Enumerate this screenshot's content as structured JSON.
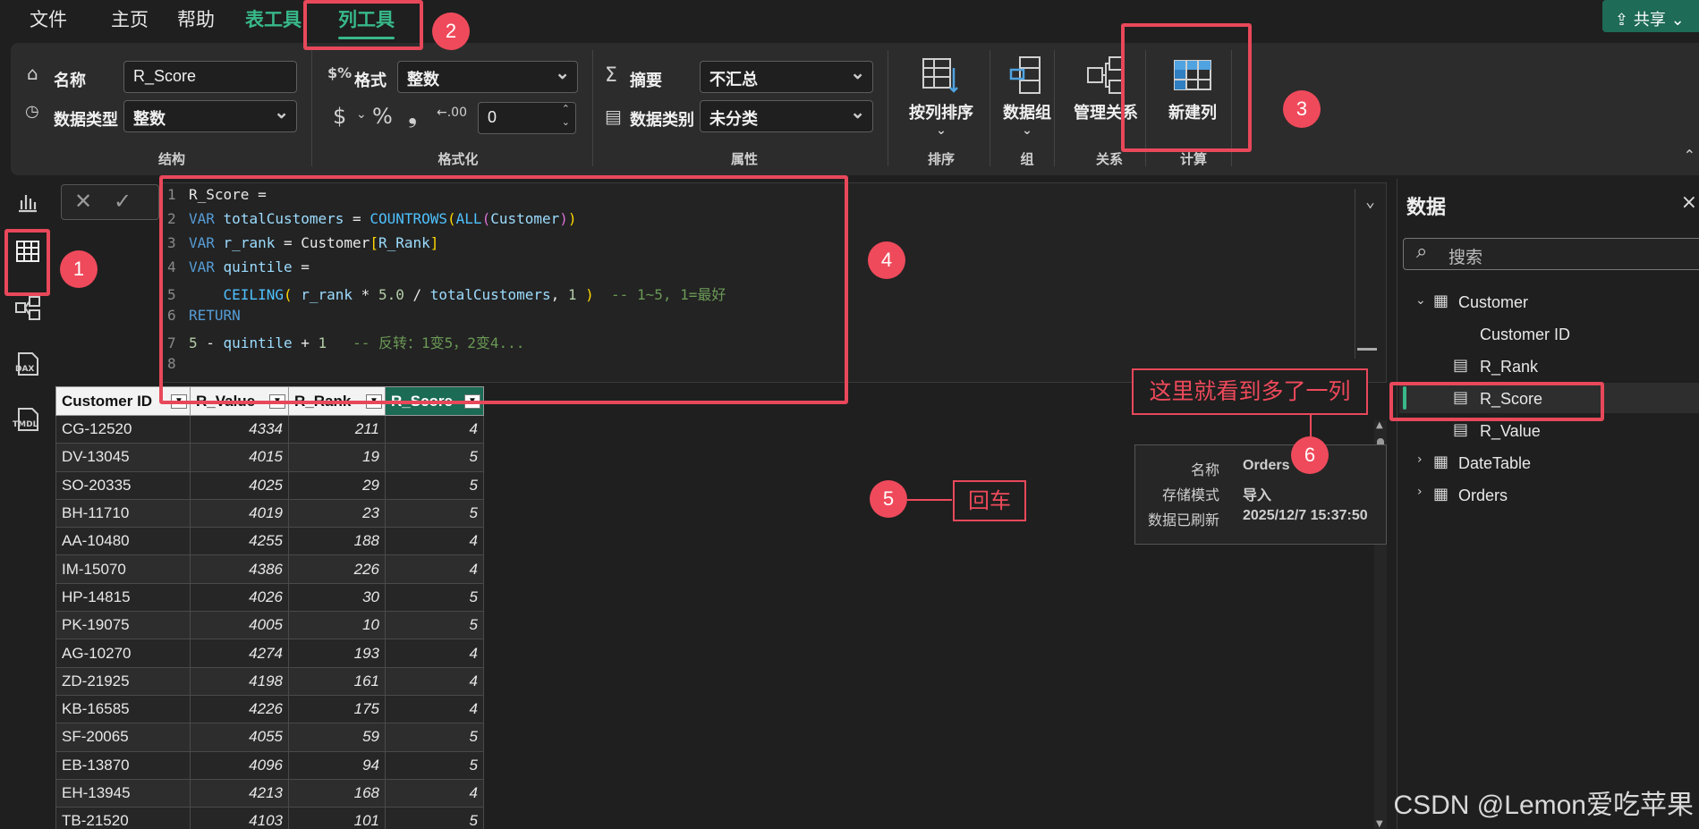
{
  "menu": {
    "file": "文件",
    "home": "主页",
    "help": "帮助",
    "table_tools": "表工具",
    "column_tools": "列工具",
    "share": "共享"
  },
  "ribbon": {
    "name_label": "名称",
    "name_value": "R_Score",
    "datatype_label": "数据类型",
    "datatype_value": "整数",
    "format_label": "格式",
    "format_value": "整数",
    "currency_symbol": "$",
    "percent_symbol": "%",
    "comma_symbol": "❟",
    "decimals_value": "0",
    "summary_label": "摘要",
    "summary_value": "不汇总",
    "category_label": "数据类别",
    "category_value": "未分类",
    "sort_by_column": "按列排序",
    "data_groups": "数据组",
    "manage_relationships": "管理关系",
    "new_column": "新建列",
    "groups": {
      "structure": "结构",
      "formatting": "格式化",
      "properties": "属性",
      "sort": "排序",
      "group": "组",
      "relationships": "关系",
      "calculations": "计算"
    }
  },
  "rail": {
    "dax": "DAX",
    "tmdl": "TMDL"
  },
  "formula": {
    "line_numbers": [
      "1",
      "2",
      "3",
      "4",
      "5",
      "6",
      "7",
      "8"
    ],
    "l1": "R_Score =",
    "l2_var": "VAR",
    "l2_name": "totalCustomers",
    "l2_eq": " = ",
    "l2_fn": "COUNTROWS",
    "l2_fn2": "ALL",
    "l2_arg": "Customer",
    "l3_var": "VAR",
    "l3_name": "r_rank",
    "l3_eq": " = ",
    "l3_ref": "Customer",
    "l3_col": "R_Rank",
    "l4_var": "VAR",
    "l4_name": "quintile",
    "l4_eq": " =",
    "l5_fn": "CEILING",
    "l5_a": "r_rank",
    "l5_op": " * ",
    "l5_num": "5.0",
    "l5_div": " / ",
    "l5_b": "totalCustomers",
    "l5_sep": ", ",
    "l5_one": "1",
    "l5_cm": "-- 1~5, 1=最好",
    "l6": "RETURN",
    "l7_num": "5",
    "l7_op": " - ",
    "l7_var": "quintile",
    "l7_plus": " + ",
    "l7_one": "1",
    "l7_cm": "-- 反转：1变5，2变4..."
  },
  "table": {
    "headers": [
      "Customer ID",
      "R_Value",
      "R_Rank",
      "R_Score"
    ],
    "rows": [
      [
        "CG-12520",
        "4334",
        "211",
        "4"
      ],
      [
        "DV-13045",
        "4015",
        "19",
        "5"
      ],
      [
        "SO-20335",
        "4025",
        "29",
        "5"
      ],
      [
        "BH-11710",
        "4019",
        "23",
        "5"
      ],
      [
        "AA-10480",
        "4255",
        "188",
        "4"
      ],
      [
        "IM-15070",
        "4386",
        "226",
        "4"
      ],
      [
        "HP-14815",
        "4026",
        "30",
        "5"
      ],
      [
        "PK-19075",
        "4005",
        "10",
        "5"
      ],
      [
        "AG-10270",
        "4274",
        "193",
        "4"
      ],
      [
        "ZD-21925",
        "4198",
        "161",
        "4"
      ],
      [
        "KB-16585",
        "4226",
        "175",
        "4"
      ],
      [
        "SF-20065",
        "4055",
        "59",
        "5"
      ],
      [
        "EB-13870",
        "4096",
        "94",
        "5"
      ],
      [
        "EH-13945",
        "4213",
        "168",
        "4"
      ],
      [
        "TB-21520",
        "4103",
        "101",
        "5"
      ]
    ]
  },
  "data_pane": {
    "title": "数据",
    "close": "×",
    "search_placeholder": "搜索",
    "tables": {
      "customer": "Customer",
      "customer_id": "Customer ID",
      "r_rank": "R_Rank",
      "r_score": "R_Score",
      "r_value": "R_Value",
      "datetable": "DateTable",
      "orders": "Orders"
    }
  },
  "tooltip": {
    "name_key": "名称",
    "name_val": "Orders",
    "storage_key": "存储模式",
    "storage_val": "导入",
    "refresh_key": "数据已刷新",
    "refresh_val": "2025/12/7 15:37:50"
  },
  "annotations": {
    "b1": "1",
    "b2": "2",
    "b3": "3",
    "b4": "4",
    "b5": "5",
    "b6": "6",
    "enter": "回车",
    "new_column_note": "这里就看到多了一列"
  },
  "watermark": "CSDN @Lemon爱吃苹果",
  "colors": {
    "accent": "#38b98a",
    "annotation_red": "#e8485a",
    "header_selected": "#1b6b55"
  }
}
